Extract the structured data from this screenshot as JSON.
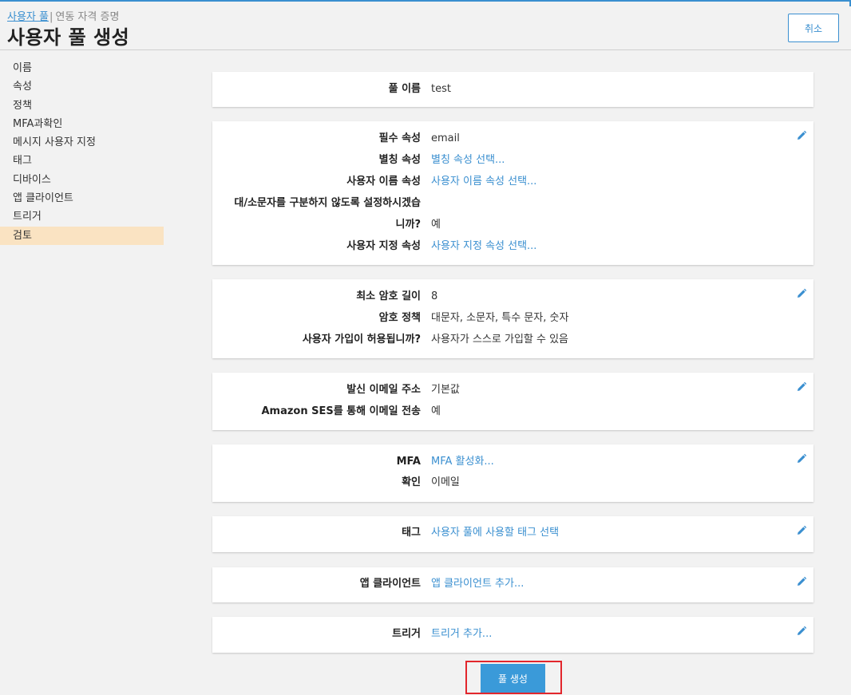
{
  "header": {
    "breadcrumb_link": "사용자 풀",
    "breadcrumb_sep": "|",
    "breadcrumb_current": "연동 자격 증명",
    "title": "사용자 풀 생성",
    "cancel_label": "취소"
  },
  "sidebar": {
    "items": [
      {
        "label": "이름"
      },
      {
        "label": "속성"
      },
      {
        "label": "정책"
      },
      {
        "label": "MFA과확인"
      },
      {
        "label": "메시지 사용자 지정"
      },
      {
        "label": "태그"
      },
      {
        "label": "디바이스"
      },
      {
        "label": "앱 클라이언트"
      },
      {
        "label": "트리거"
      },
      {
        "label": "검토"
      }
    ],
    "active_index": 9
  },
  "sections": {
    "name": {
      "pool_name_label": "풀 이름",
      "pool_name_value": "test"
    },
    "attributes": {
      "required_label": "필수 속성",
      "required_value": "email",
      "alias_label": "별칭 속성",
      "alias_value": "별칭 속성 선택...",
      "username_label": "사용자 이름 속성",
      "username_value": "사용자 이름 속성 선택...",
      "case_label_line1": "대/소문자를 구분하지 않도록 설정하시겠습",
      "case_label_line2": "니까?",
      "case_value": "예",
      "custom_label": "사용자 지정 속성",
      "custom_value": "사용자 지정 속성 선택..."
    },
    "policies": {
      "min_length_label": "최소 암호 길이",
      "min_length_value": "8",
      "policy_label": "암호 정책",
      "policy_value": "대문자, 소문자, 특수 문자, 숫자",
      "signup_label": "사용자 가입이 허용됩니까?",
      "signup_value": "사용자가 스스로 가입할 수 있음"
    },
    "messages": {
      "from_email_label": "발신 이메일 주소",
      "from_email_value": "기본값",
      "ses_label": "Amazon SES를 통해 이메일 전송",
      "ses_value": "예"
    },
    "mfa": {
      "mfa_label": "MFA",
      "mfa_value": "MFA 활성화...",
      "verify_label": "확인",
      "verify_value": "이메일"
    },
    "tags": {
      "tags_label": "태그",
      "tags_value": "사용자 풀에 사용할 태그 선택"
    },
    "app_clients": {
      "label": "앱 클라이언트",
      "value": "앱 클라이언트 추가..."
    },
    "triggers": {
      "label": "트리거",
      "value": "트리거 추가..."
    }
  },
  "footer": {
    "create_label": "풀 생성"
  },
  "colors": {
    "accent": "#3a8fd0",
    "active_nav": "#fae3c2",
    "highlight": "#e2262c",
    "primary_button": "#3a9ad9"
  }
}
